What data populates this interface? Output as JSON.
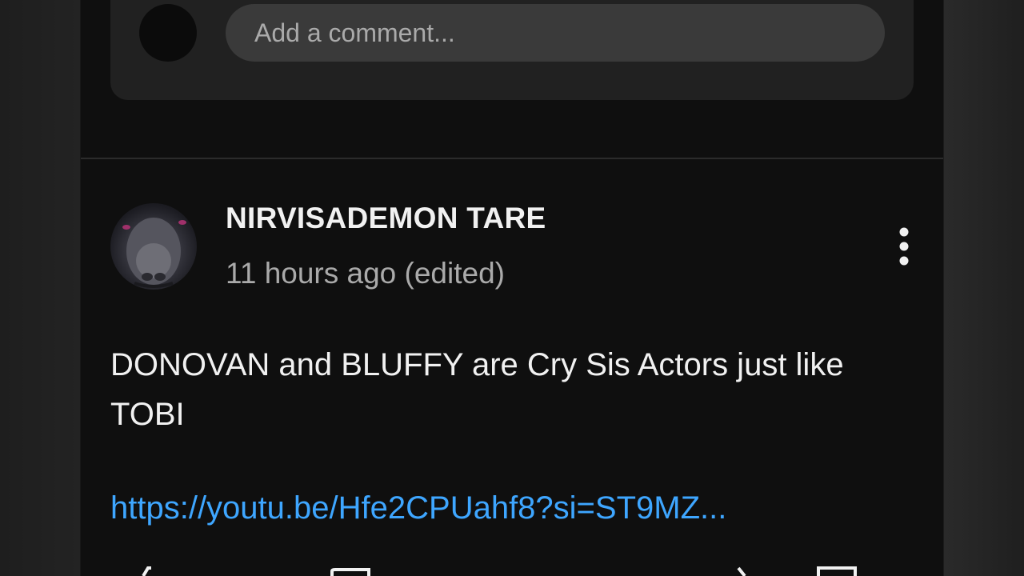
{
  "composer": {
    "placeholder": "Add a comment..."
  },
  "comment": {
    "author": "NIRVISADEMON TARE",
    "timestamp": "11 hours ago (edited)",
    "text": "DONOVAN and BLUFFY are Cry Sis Actors just like TOBI",
    "link": "https://youtu.be/Hfe2CPUahf8?si=ST9MZ...",
    "menu_icon": "more-vert-icon"
  },
  "actions": {
    "icons": [
      "like-icon",
      "dislike-icon",
      "share-icon",
      "reply-icon"
    ]
  },
  "colors": {
    "background": "#0f0f0f",
    "composer_bg": "#212121",
    "input_bg": "#3a3a3a",
    "link": "#3ea6ff",
    "primary_text": "#f1f1f1",
    "secondary_text": "#aaaaaa"
  }
}
